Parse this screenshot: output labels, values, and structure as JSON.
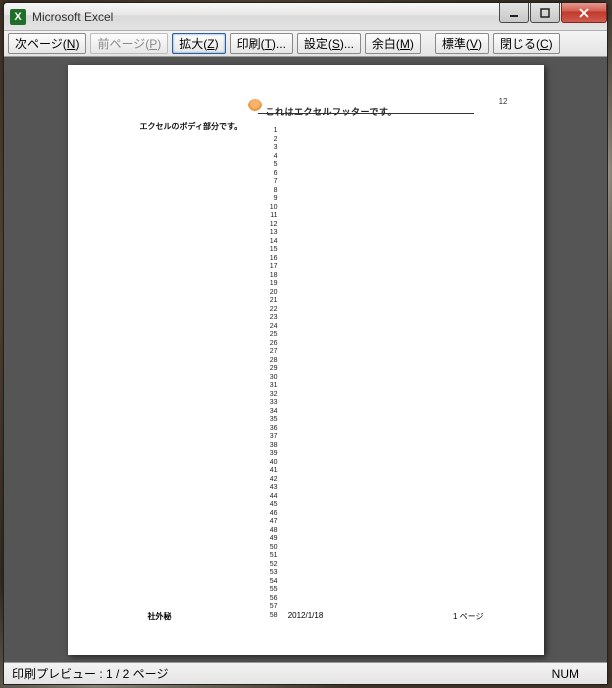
{
  "window": {
    "title": "Microsoft Excel"
  },
  "toolbar": {
    "next": {
      "label_pre": "次ページ(",
      "accel": "N",
      "label_post": ")"
    },
    "prev": {
      "label_pre": "前ページ(",
      "accel": "P",
      "label_post": ")"
    },
    "zoom": {
      "label_pre": "拡大(",
      "accel": "Z",
      "label_post": ")"
    },
    "print": {
      "label_pre": "印刷(",
      "accel": "T",
      "label_post": ")..."
    },
    "setup": {
      "label_pre": "設定(",
      "accel": "S",
      "label_post": ")..."
    },
    "margin": {
      "label_pre": "余白(",
      "accel": "M",
      "label_post": ")"
    },
    "normal": {
      "label_pre": "標準(",
      "accel": "V",
      "label_post": ")"
    },
    "close": {
      "label_pre": "閉じる(",
      "accel": "C",
      "label_post": ")"
    }
  },
  "preview": {
    "header_number": "12",
    "header_text": "これはエクセルフッターです。",
    "body_label": "エクセルのボディ部分です。",
    "row_count": 58,
    "footer_left": "社外秘",
    "footer_center": "2012/1/18",
    "footer_right": "1 ページ"
  },
  "status": {
    "left": "印刷プレビュー : 1 / 2 ページ",
    "indicator": "NUM"
  }
}
